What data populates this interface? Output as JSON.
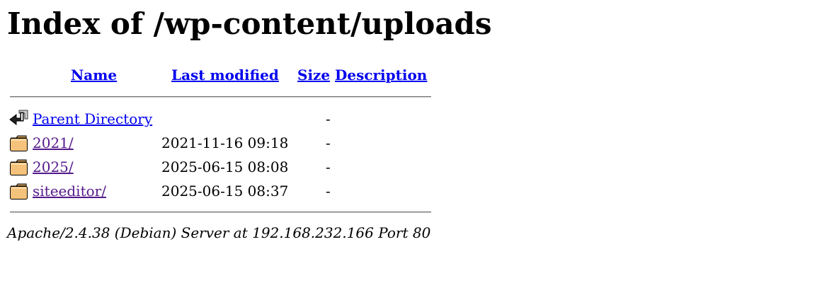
{
  "title": "Index of /wp-content/uploads",
  "columns": {
    "name": "Name",
    "last_modified": "Last modified",
    "size": "Size",
    "description": "Description"
  },
  "entries": [
    {
      "icon": "back-arrow-icon",
      "name": "Parent Directory",
      "date": "",
      "size": "-"
    },
    {
      "icon": "folder-icon",
      "name": "2021/",
      "date": "2021-11-16 09:18",
      "size": "-"
    },
    {
      "icon": "folder-icon",
      "name": "2025/",
      "date": "2025-06-15 08:08",
      "size": "-"
    },
    {
      "icon": "folder-icon",
      "name": "siteeditor/",
      "date": "2025-06-15 08:37",
      "size": "-"
    }
  ],
  "footer": "Apache/2.4.38 (Debian) Server at 192.168.232.166 Port 80",
  "colors": {
    "link": "#0000ee",
    "visited_link": "#551a8b",
    "folder_fill": "#f4c27a"
  }
}
